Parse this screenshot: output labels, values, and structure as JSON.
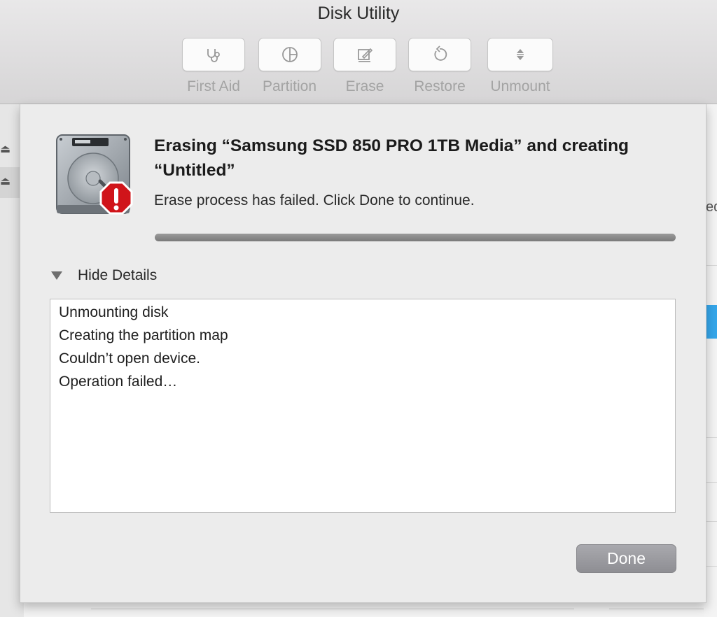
{
  "window": {
    "title": "Disk Utility"
  },
  "toolbar": {
    "items": [
      {
        "label": "First Aid",
        "icon": "stethoscope-icon"
      },
      {
        "label": "Partition",
        "icon": "pie-chart-icon"
      },
      {
        "label": "Erase",
        "icon": "erase-icon"
      },
      {
        "label": "Restore",
        "icon": "restore-icon"
      },
      {
        "label": "Unmount",
        "icon": "unmount-icon"
      }
    ]
  },
  "sheet": {
    "title": "Erasing “Samsung SSD 850 PRO 1TB Media” and creating “Untitled”",
    "message": "Erase process has failed. Click Done to continue.",
    "progress": 1.0,
    "details_toggle_label": "Hide Details",
    "log_lines": [
      "Unmounting disk",
      "Creating the partition map",
      "Couldn’t open device.",
      "Operation failed…"
    ],
    "done_label": "Done"
  },
  "background": {
    "partial_text": "ed"
  },
  "colors": {
    "error_badge": "#d0141a",
    "selection_blue": "#35a6ea",
    "done_button": "#9d9da2"
  }
}
